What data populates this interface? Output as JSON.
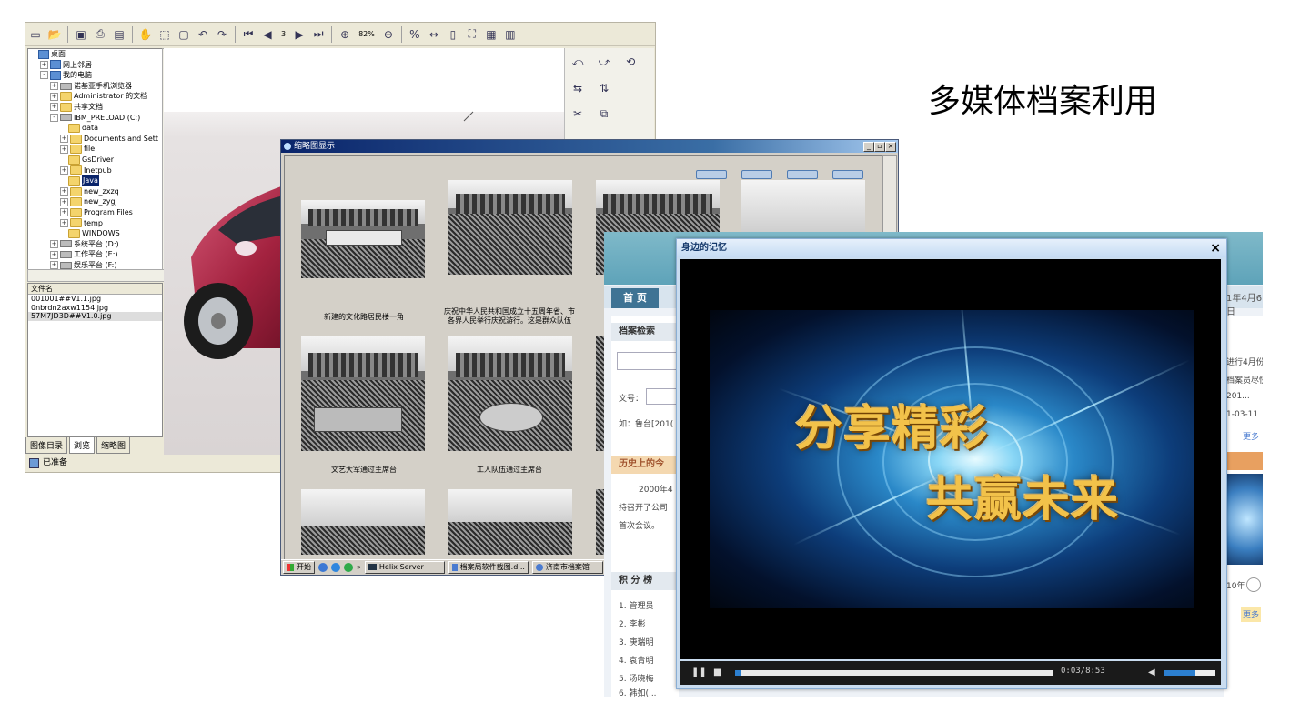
{
  "heading": "多媒体档案利用",
  "browser": {
    "toolbar": {
      "page_number": "3",
      "zoom": "82%"
    },
    "tree": [
      {
        "label": "桌面",
        "icon": "pc",
        "indent": 0,
        "exp": ""
      },
      {
        "label": "网上邻居",
        "icon": "pc",
        "indent": 1,
        "exp": "+"
      },
      {
        "label": "我的电脑",
        "icon": "pc",
        "indent": 1,
        "exp": "-"
      },
      {
        "label": "诺基亚手机浏览器",
        "icon": "drv",
        "indent": 2,
        "exp": "+"
      },
      {
        "label": "Administrator 的文档",
        "icon": "fold",
        "indent": 2,
        "exp": "+"
      },
      {
        "label": "共享文档",
        "icon": "fold",
        "indent": 2,
        "exp": "+"
      },
      {
        "label": "IBM_PRELOAD (C:)",
        "icon": "drv",
        "indent": 2,
        "exp": "-"
      },
      {
        "label": "data",
        "icon": "fold",
        "indent": 3,
        "exp": ""
      },
      {
        "label": "Documents and Sett",
        "icon": "fold",
        "indent": 3,
        "exp": "+"
      },
      {
        "label": "file",
        "icon": "fold",
        "indent": 3,
        "exp": "+"
      },
      {
        "label": "GsDriver",
        "icon": "fold",
        "indent": 3,
        "exp": ""
      },
      {
        "label": "Inetpub",
        "icon": "fold",
        "indent": 3,
        "exp": "+"
      },
      {
        "label": "Java",
        "icon": "fold",
        "indent": 3,
        "exp": "",
        "selected": true
      },
      {
        "label": "new_zxzq",
        "icon": "fold",
        "indent": 3,
        "exp": "+"
      },
      {
        "label": "new_zygj",
        "icon": "fold",
        "indent": 3,
        "exp": "+"
      },
      {
        "label": "Program Files",
        "icon": "fold",
        "indent": 3,
        "exp": "+"
      },
      {
        "label": "temp",
        "icon": "fold",
        "indent": 3,
        "exp": "+"
      },
      {
        "label": "WINDOWS",
        "icon": "fold",
        "indent": 3,
        "exp": ""
      },
      {
        "label": "系统平台 (D:)",
        "icon": "drv",
        "indent": 2,
        "exp": "+"
      },
      {
        "label": "工作平台 (E:)",
        "icon": "drv",
        "indent": 2,
        "exp": "+"
      },
      {
        "label": "娱乐平台 (F:)",
        "icon": "drv",
        "indent": 2,
        "exp": "+"
      }
    ],
    "filelist": {
      "header": "文件名",
      "files": [
        "001001##V1.1.jpg",
        "0nbrdn2axw1154.jpg",
        "57M7JD3D##V1.0.jpg"
      ]
    },
    "tabs": [
      "图像目录",
      "浏览",
      "缩略图"
    ],
    "status": "已准备"
  },
  "thumbs_window": {
    "title": "缩略图显示",
    "captions": [
      "新建的文化路居民楼一角",
      "庆祝中华人民共和国成立十五周年省、市各界人民举行庆祝游行。这是群众队伍",
      "庆",
      "文艺大军通过主席台",
      "工人队伍通过主席台"
    ],
    "taskbar": {
      "start": "开始",
      "items": [
        "Helix Server",
        "档案局软件截图.d...",
        "济南市档案馆"
      ]
    }
  },
  "website": {
    "home": "首 页",
    "date": "1年4月6日",
    "left": {
      "search_title": "档案检索",
      "field_label": "文号：",
      "example": "如：鲁台[201(",
      "history_title": "历史上的今",
      "history_year": "2000年4",
      "history_text1": "持召开了公司",
      "history_text2": "首次会议。",
      "rank_title": "积 分 榜",
      "rank": [
        "1. 管理员",
        "2. 李彬",
        "3. 庚瑞明",
        "4. 袁青明",
        "5. 汤晓梅",
        "6. 韩如(..."
      ]
    },
    "right": {
      "l1": "进行4月份",
      "l2": "档案员尽快",
      "l3": "201...",
      "l4": "1-03-11",
      "more1": "更多",
      "year": "10年",
      "more2": "更多"
    }
  },
  "video_player": {
    "title": "身边的记忆",
    "close": "×",
    "line1": "分享精彩",
    "line2": "共赢未来",
    "time": "0:03/8:53",
    "progress": 0.006,
    "volume": 0.6
  }
}
